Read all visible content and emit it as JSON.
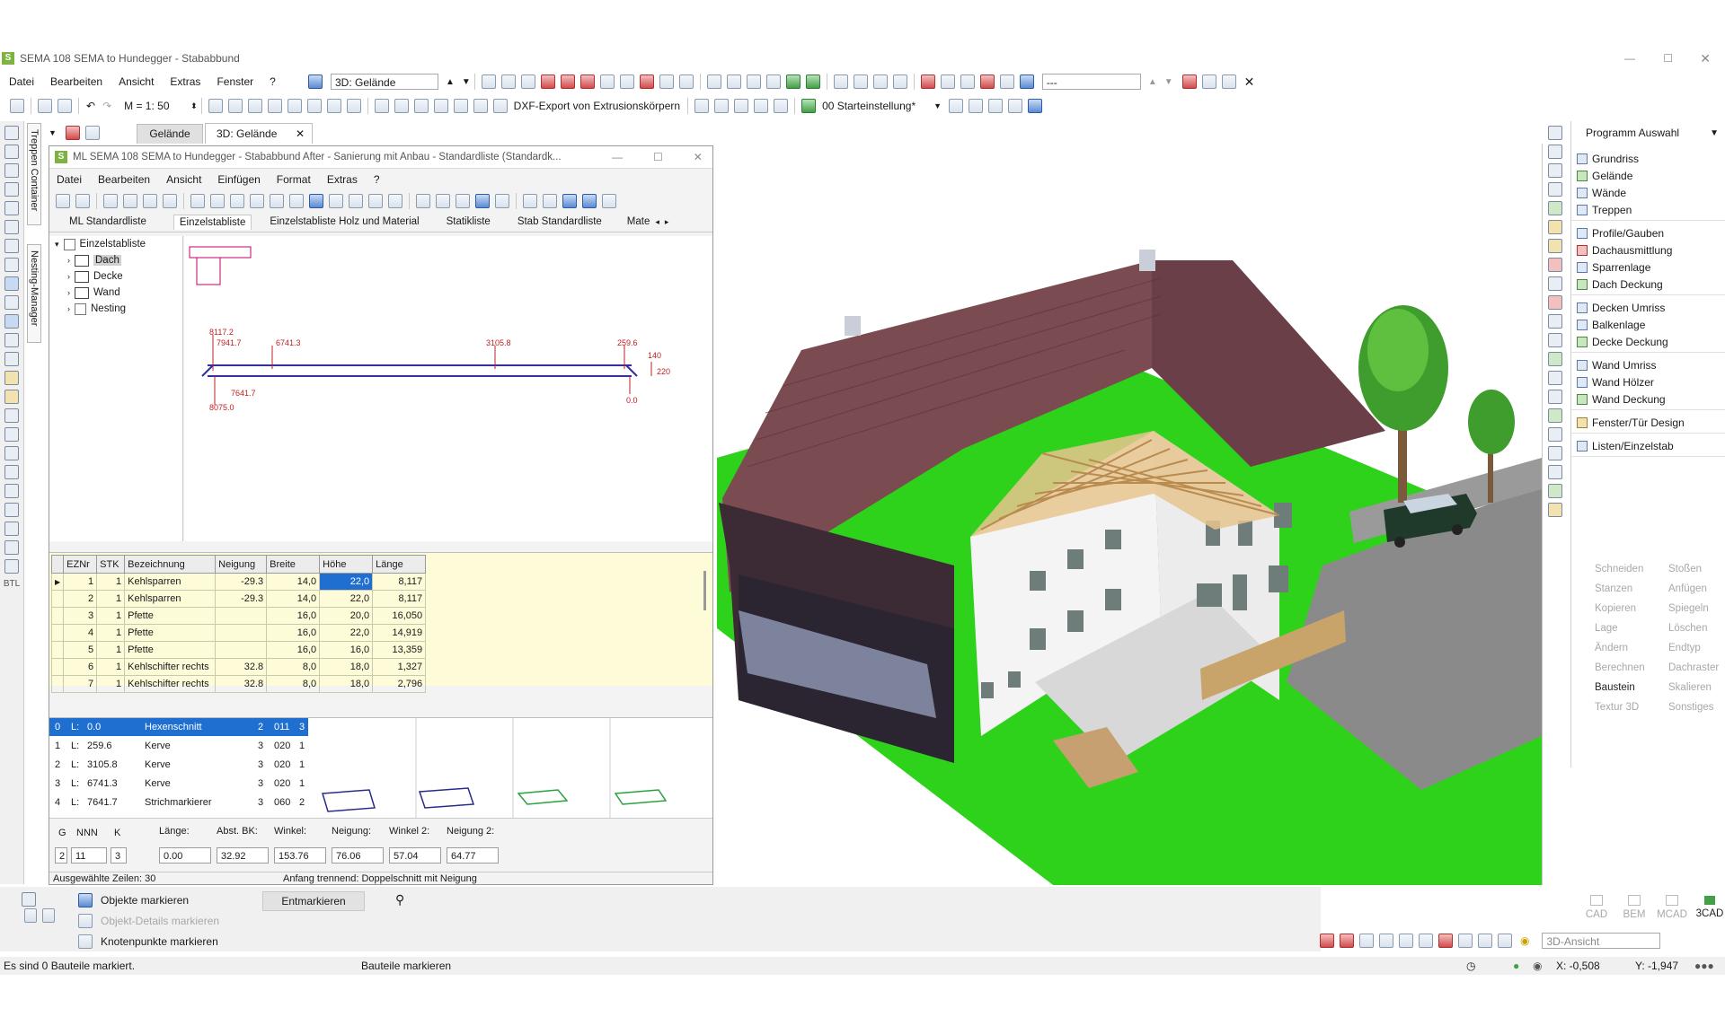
{
  "window": {
    "title": "SEMA  108 SEMA to Hundegger - Stababbund"
  },
  "menu": [
    "Datei",
    "Bearbeiten",
    "Ansicht",
    "Extras",
    "Fenster",
    "?"
  ],
  "toolbar": {
    "view_combo": "3D: Gelände",
    "scale": "M = 1: 50",
    "dxf_label": "DXF-Export von Extrusionskörpern",
    "start_combo": "00 Starteinstellung*",
    "right_combo": "---"
  },
  "tabs": [
    "Gelände",
    "3D: Gelände"
  ],
  "side_tabs": [
    "Treppen Container",
    "Nesting-Manager"
  ],
  "left_bottom_label": "BTL",
  "child_window": {
    "title": "ML SEMA  108 SEMA to Hundegger - Stababbund After - Sanierung mit Anbau  - Standardliste (Standardk...",
    "menu": [
      "Datei",
      "Bearbeiten",
      "Ansicht",
      "Einfügen",
      "Format",
      "Extras",
      "?"
    ],
    "list_tabs": [
      "ML Standardliste",
      "Einzelstabliste",
      "Einzelstabliste Holz und Material",
      "Statikliste",
      "Stab Standardliste",
      "Mate"
    ],
    "tree": {
      "root": "Einzelstabliste",
      "children": [
        "Dach",
        "Decke",
        "Wand",
        "Nesting"
      ]
    },
    "drawing_labels": {
      "top": [
        "8117.2",
        "7941.7",
        "6741.3",
        "3105.8",
        "259.6"
      ],
      "bottom": [
        "7641.7",
        "8075.0",
        "0.0"
      ],
      "side": [
        "140",
        "220"
      ]
    },
    "table": {
      "headers": [
        "EZNr",
        "STK",
        "Bezeichnung",
        "Neigung",
        "Breite",
        "Höhe",
        "Länge"
      ],
      "rows": [
        [
          "1",
          "1",
          "Kehlsparren",
          "-29.3",
          "14,0",
          "22,0",
          "8,117"
        ],
        [
          "2",
          "1",
          "Kehlsparren",
          "-29.3",
          "14,0",
          "22,0",
          "8,117"
        ],
        [
          "3",
          "1",
          "Pfette",
          "",
          "16,0",
          "20,0",
          "16,050"
        ],
        [
          "4",
          "1",
          "Pfette",
          "",
          "16,0",
          "22,0",
          "14,919"
        ],
        [
          "5",
          "1",
          "Pfette",
          "",
          "16,0",
          "16,0",
          "13,359"
        ],
        [
          "6",
          "1",
          "Kehlschifter rechts",
          "32.8",
          "8,0",
          "18,0",
          "1,327"
        ],
        [
          "7",
          "1",
          "Kehlschifter rechts",
          "32.8",
          "8,0",
          "18,0",
          "2,796"
        ]
      ]
    },
    "process_list": [
      [
        "0",
        "L:",
        "0.0",
        "Hexenschnitt",
        "2",
        "011",
        "3"
      ],
      [
        "1",
        "L:",
        "259.6",
        "Kerve",
        "3",
        "020",
        "1"
      ],
      [
        "2",
        "L:",
        "3105.8",
        "Kerve",
        "3",
        "020",
        "1"
      ],
      [
        "3",
        "L:",
        "6741.3",
        "Kerve",
        "3",
        "020",
        "1"
      ],
      [
        "4",
        "L:",
        "7641.7",
        "Strichmarkierer",
        "3",
        "060",
        "2"
      ]
    ],
    "params": {
      "labels": [
        "G",
        "NNN",
        "K",
        "Länge:",
        "Abst. BK:",
        "Winkel:",
        "Neigung:",
        "Winkel 2:",
        "Neigung 2:"
      ],
      "values": [
        "2",
        "11",
        "3",
        "0.00",
        "32.92",
        "153.76",
        "76.06",
        "57.04",
        "64.77"
      ]
    },
    "status_left": "Ausgewählte Zeilen: 30",
    "status_right": "Anfang trennend: Doppelschnitt mit Neigung"
  },
  "right_panel": {
    "header": "Programm Auswahl",
    "groups": [
      [
        "Grundriss",
        "Gelände",
        "Wände",
        "Treppen"
      ],
      [
        "Profile/Gauben",
        "Dachausmittlung",
        "Sparrenlage",
        "Dach Deckung"
      ],
      [
        "Decken Umriss",
        "Balkenlage",
        "Decke Deckung"
      ],
      [
        "Wand Umriss",
        "Wand Hölzer",
        "Wand Deckung"
      ],
      [
        "Fenster/Tür Design"
      ],
      [
        "Listen/Einzelstab"
      ]
    ],
    "tools_left": [
      "Schneiden",
      "Stanzen",
      "Kopieren",
      "Lage",
      "Ändern",
      "Berechnen",
      "Baustein",
      "Textur 3D"
    ],
    "tools_right": [
      "Stoßen",
      "Anfügen",
      "Spiegeln",
      "Löschen",
      "Endtyp",
      "Dachraster",
      "Skalieren",
      "Sonstiges"
    ],
    "modes": [
      "CAD",
      "BEM",
      "MCAD",
      "3CAD"
    ],
    "view_combo": "3D-Ansicht"
  },
  "bottom_panel": {
    "items": [
      "Objekte markieren",
      "Objekt-Details markieren",
      "Knotenpunkte markieren"
    ],
    "unmark_button": "Entmarkieren"
  },
  "statusbar": {
    "left": "Es sind 0 Bauteile markiert.",
    "mid": "Bauteile markieren",
    "x": "X: -0,508",
    "y": "Y: -1,947"
  },
  "colors": {
    "selection": "#1f6fd1",
    "grid_bg": "#fefbd8",
    "ground": "#2fd21b"
  }
}
